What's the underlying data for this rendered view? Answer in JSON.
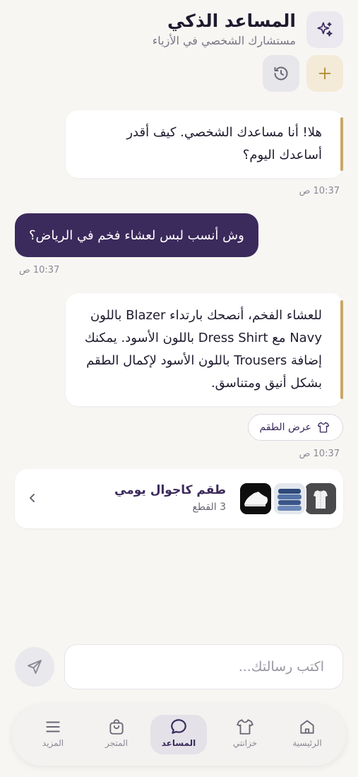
{
  "header": {
    "title": "المساعد الذكي",
    "subtitle": "مستشارك الشخصي في الأزياء",
    "sparkle_icon": "sparkles-icon",
    "new_chat_icon": "plus-icon",
    "history_icon": "history-icon"
  },
  "messages": [
    {
      "role": "assistant",
      "text_line1": "هلا! أنا مساعدك الشخصي. كيف أقدر",
      "text_line2": "أساعدك اليوم؟",
      "time": "10:37 ص"
    },
    {
      "role": "user",
      "text": "وش أنسب لبس لعشاء فخم في الرياض؟",
      "time": "10:37 ص"
    },
    {
      "role": "assistant",
      "lines": [
        "للعشاء الفخم، أنصحك بارتداء Blazer باللون",
        "Navy مع Dress Shirt باللون الأسود. يمكنك",
        "إضافة Trousers باللون الأسود لإكمال الطقم",
        "بشكل أنيق ومتناسق."
      ],
      "time": "10:37 ص"
    }
  ],
  "view_outfit": {
    "label": "عرض الطقم",
    "icon": "shirt-icon"
  },
  "outfit_card": {
    "name": "طقم كاجوال يومي",
    "count": "3 القطع"
  },
  "composer": {
    "placeholder": "اكتب رسالتك...",
    "send_icon": "send-icon"
  },
  "nav": [
    {
      "label": "الرئيسية",
      "icon": "home-icon",
      "active": false
    },
    {
      "label": "خزانتي",
      "icon": "shirt-icon",
      "active": false
    },
    {
      "label": "المساعد",
      "icon": "chat-icon",
      "active": true
    },
    {
      "label": "المتجر",
      "icon": "bag-icon",
      "active": false
    },
    {
      "label": "المزيد",
      "icon": "menu-icon",
      "active": false
    }
  ],
  "colors": {
    "accent": "#3b2a5c",
    "gold": "#c9a968",
    "background": "#f7f6f3"
  }
}
